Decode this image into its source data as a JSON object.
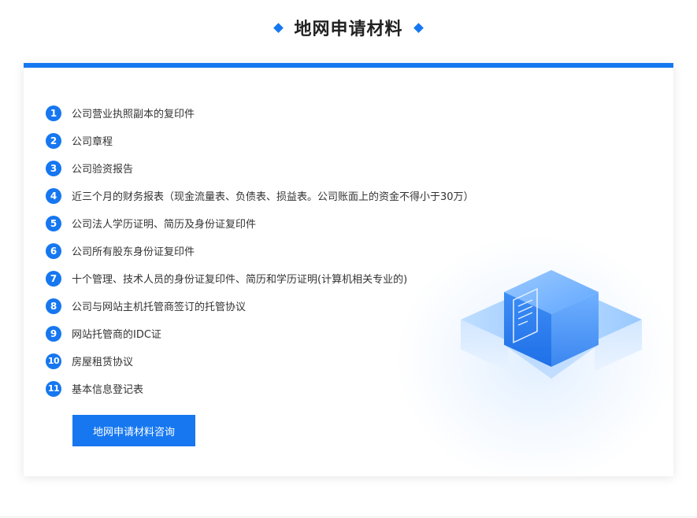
{
  "header": {
    "title": "地网申请材料"
  },
  "colors": {
    "accent": "#1677f0",
    "text": "#333333",
    "title": "#222222"
  },
  "materials": [
    {
      "num": "1",
      "text": "公司营业执照副本的复印件"
    },
    {
      "num": "2",
      "text": "公司章程"
    },
    {
      "num": "3",
      "text": "公司验资报告"
    },
    {
      "num": "4",
      "text": "近三个月的财务报表（现金流量表、负债表、损益表。公司账面上的资金不得小于30万）"
    },
    {
      "num": "5",
      "text": "公司法人学历证明、简历及身份证复印件"
    },
    {
      "num": "6",
      "text": "公司所有股东身份证复印件"
    },
    {
      "num": "7",
      "text": "十个管理、技术人员的身份证复印件、简历和学历证明(计算机相关专业的)"
    },
    {
      "num": "8",
      "text": "公司与网站主机托管商签订的托管协议"
    },
    {
      "num": "9",
      "text": "网站托管商的IDC证"
    },
    {
      "num": "10",
      "text": "房屋租赁协议"
    },
    {
      "num": "11",
      "text": "基本信息登记表"
    }
  ],
  "consult_button": {
    "label": "地网申请材料咨询"
  },
  "illustration": {
    "icon": "server-document-icon"
  }
}
